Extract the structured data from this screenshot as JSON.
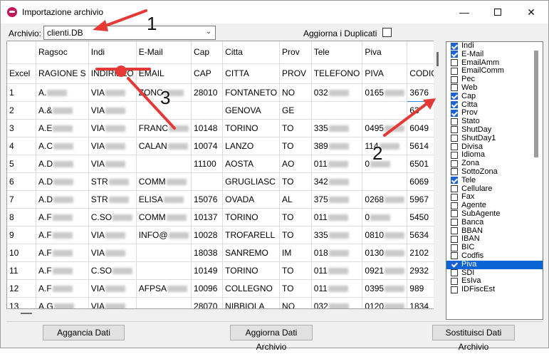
{
  "window": {
    "title": "Importazione archivio",
    "min_glyph": "—",
    "close_glyph": "✕"
  },
  "toolbar": {
    "archivio_label": "Archivio:",
    "archivio_value": "clienti.DB",
    "aggiorna_duplicati_label": "Aggiorna i Duplicati",
    "aggiorna_duplicati_checked": false
  },
  "grid": {
    "header1": [
      "",
      "Ragsoc",
      "Indi",
      "E-Mail",
      "Cap",
      "Citta",
      "Prov",
      "Tele",
      "Piva",
      ""
    ],
    "header2": [
      "Excel",
      "RAGIONE S",
      "INDIRIZZO",
      "EMAIL",
      "CAP",
      "CITTA",
      "PROV",
      "TELEFONO",
      "PIVA",
      "CODIC"
    ],
    "rows": [
      [
        "1",
        "A.",
        "VIA",
        "ZONC",
        "28010",
        "FONTANETO",
        "NO",
        "032",
        "0165",
        "3676"
      ],
      [
        "2",
        "A.&",
        "VIA",
        "",
        "",
        "GENOVA",
        "GE",
        "",
        "",
        "63"
      ],
      [
        "3",
        "A.E",
        "VIA",
        "FRANC",
        "10148",
        "TORINO",
        "TO",
        "335",
        "0495",
        "6049"
      ],
      [
        "4",
        "A.C",
        "VIA",
        "CALAN",
        "10074",
        "LANZO",
        "TO",
        "389",
        "114",
        "5614"
      ],
      [
        "5",
        "A.D",
        "VIA",
        "",
        "11100",
        "AOSTA",
        "AO",
        "011",
        "0",
        "6501"
      ],
      [
        "6",
        "A.D",
        "STR",
        "COMM",
        "",
        "GRUGLIASC",
        "TO",
        "342",
        "",
        "6069"
      ],
      [
        "7",
        "A.D",
        "STR",
        "ELISA",
        "15076",
        "OVADA",
        "AL",
        "375",
        "0268",
        "5967"
      ],
      [
        "8",
        "A.F",
        "C.SO",
        "COMM",
        "10137",
        "TORINO",
        "TO",
        "011",
        "0",
        "5450"
      ],
      [
        "9",
        "A.F",
        "VIA",
        "INFO@",
        "10028",
        "TROFARELL",
        "TO",
        "335",
        "0810",
        "5634"
      ],
      [
        "10",
        "A.F",
        "VIA",
        "",
        "18038",
        "SANREMO",
        "IM",
        "018",
        "0130",
        "2102"
      ],
      [
        "11",
        "A.F",
        "C.SO",
        "",
        "10149",
        "TORINO",
        "TO",
        "011",
        "0921",
        "2932"
      ],
      [
        "12",
        "A.F",
        "VIA",
        "AFPSA",
        "10096",
        "COLLEGNO",
        "TO",
        "011",
        "0395",
        "989"
      ],
      [
        "13",
        "A.G",
        "VIA",
        "",
        "28070",
        "NIBBIOLA",
        "NO",
        "032",
        "0120",
        "1834"
      ]
    ]
  },
  "fields": [
    {
      "label": "Indi",
      "checked": true
    },
    {
      "label": "E-Mail",
      "checked": true
    },
    {
      "label": "EmailAmm",
      "checked": false
    },
    {
      "label": "EmailComm",
      "checked": false
    },
    {
      "label": "Pec",
      "checked": false
    },
    {
      "label": "Web",
      "checked": false
    },
    {
      "label": "Cap",
      "checked": true
    },
    {
      "label": "Citta",
      "checked": true
    },
    {
      "label": "Prov",
      "checked": true
    },
    {
      "label": "Stato",
      "checked": false
    },
    {
      "label": "ShutDay",
      "checked": false
    },
    {
      "label": "ShutDay1",
      "checked": false
    },
    {
      "label": "Divisa",
      "checked": false
    },
    {
      "label": "Idioma",
      "checked": false
    },
    {
      "label": "Zona",
      "checked": false
    },
    {
      "label": "SottoZona",
      "checked": false
    },
    {
      "label": "Tele",
      "checked": true
    },
    {
      "label": "Cellulare",
      "checked": false
    },
    {
      "label": "Fax",
      "checked": false
    },
    {
      "label": "Agente",
      "checked": false
    },
    {
      "label": "SubAgente",
      "checked": false
    },
    {
      "label": "Banca",
      "checked": false
    },
    {
      "label": "BBAN",
      "checked": false
    },
    {
      "label": "IBAN",
      "checked": false
    },
    {
      "label": "BIC",
      "checked": false
    },
    {
      "label": "Codfis",
      "checked": false
    },
    {
      "label": "Piva",
      "checked": true,
      "highlighted": true
    },
    {
      "label": "SDI",
      "checked": false
    },
    {
      "label": "EsIva",
      "checked": false
    },
    {
      "label": "IDFiscEst",
      "checked": false
    }
  ],
  "buttons": {
    "aggancia": "Aggancia Dati",
    "aggiorna": "Aggiorna Dati Archivio",
    "sostituisci": "Sostituisci Dati Archivio"
  },
  "annotations": {
    "n1": "1",
    "n2": "2",
    "n3": "3",
    "color": "#e53935"
  }
}
